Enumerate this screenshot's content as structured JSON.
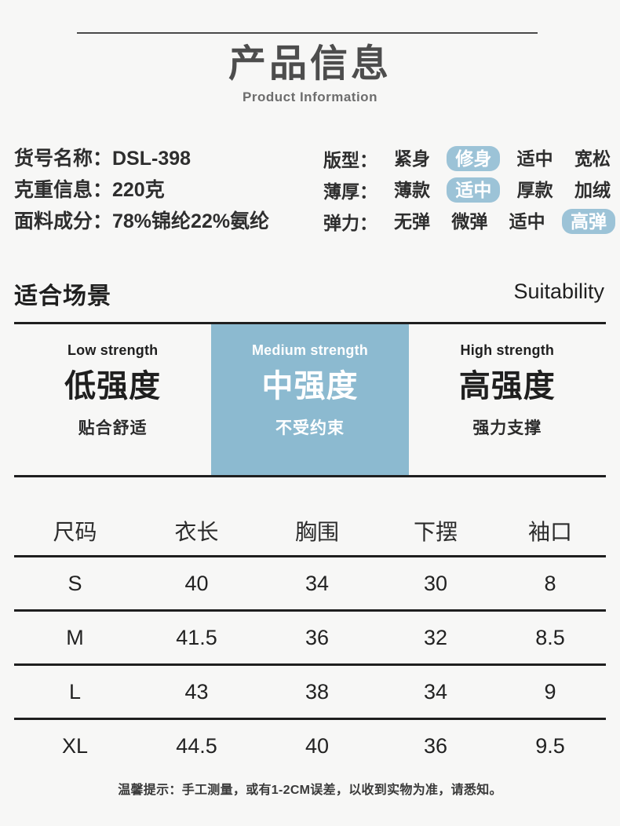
{
  "header": {
    "title_cn": "产品信息",
    "title_en": "Product Information"
  },
  "specs": {
    "lines": [
      "货号名称：DSL-398",
      "克重信息：220克",
      "面料成分：78%锦纶22%氨纶"
    ]
  },
  "attributes": {
    "accent_color": "#9cc3d7",
    "rows": [
      {
        "label": "版型：",
        "options": [
          "紧身",
          "修身",
          "适中",
          "宽松"
        ],
        "selected": "修身"
      },
      {
        "label": "薄厚：",
        "options": [
          "薄款",
          "适中",
          "厚款",
          "加绒"
        ],
        "selected": "适中"
      },
      {
        "label": "弹力：",
        "options": [
          "无弹",
          "微弹",
          "适中",
          "高弹"
        ],
        "selected": "高弹"
      }
    ]
  },
  "suitability": {
    "heading_cn": "适合场景",
    "heading_en": "Suitability",
    "highlight_color": "#8cbad0",
    "columns": [
      {
        "en": "Low strength",
        "cn": "低强度",
        "sub": "贴合舒适",
        "highlight": false
      },
      {
        "en": "Medium strength",
        "cn": "中强度",
        "sub": "不受约束",
        "highlight": true
      },
      {
        "en": "High strength",
        "cn": "高强度",
        "sub": "强力支撑",
        "highlight": false
      }
    ]
  },
  "size_table": {
    "headers": [
      "尺码",
      "衣长",
      "胸围",
      "下摆",
      "袖口"
    ],
    "rows": [
      [
        "S",
        "40",
        "34",
        "30",
        "8"
      ],
      [
        "M",
        "41.5",
        "36",
        "32",
        "8.5"
      ],
      [
        "L",
        "43",
        "38",
        "34",
        "9"
      ],
      [
        "XL",
        "44.5",
        "40",
        "36",
        "9.5"
      ]
    ]
  },
  "footnote": "温馨提示：手工测量，或有1-2CM误差，以收到实物为准，请悉知。"
}
